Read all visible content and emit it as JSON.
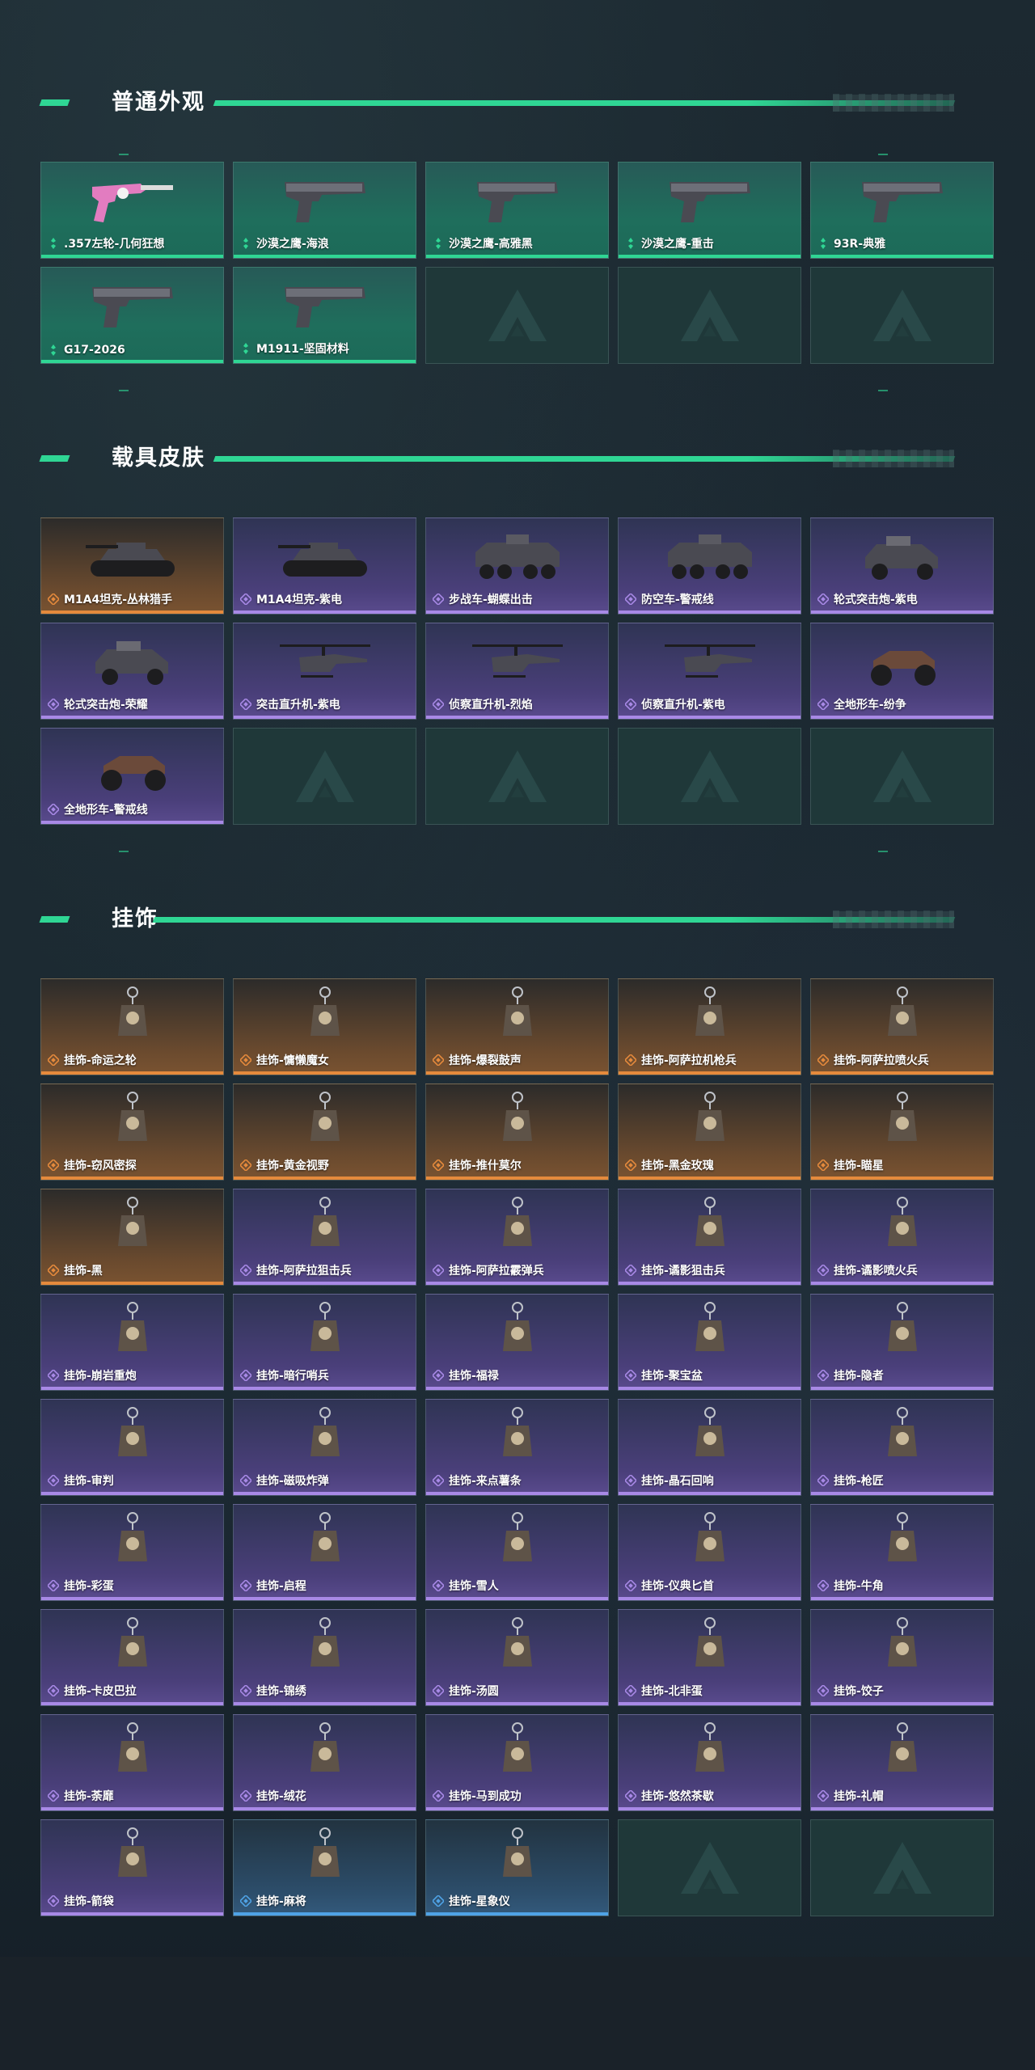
{
  "sections": [
    {
      "title": "普通外观",
      "items": [
        {
          "label": ".357左轮-几何狂想",
          "rarity": "green",
          "icon": "revolver-icon"
        },
        {
          "label": "沙漠之鹰-海浪",
          "rarity": "green",
          "icon": "pistol-icon"
        },
        {
          "label": "沙漠之鹰-高雅黑",
          "rarity": "green",
          "icon": "pistol-icon"
        },
        {
          "label": "沙漠之鹰-重击",
          "rarity": "green",
          "icon": "pistol-icon"
        },
        {
          "label": "93R-典雅",
          "rarity": "green",
          "icon": "pistol-icon"
        },
        {
          "label": "G17-2026",
          "rarity": "green",
          "icon": "pistol-icon"
        },
        {
          "label": "M1911-坚固材料",
          "rarity": "green",
          "icon": "pistol-icon"
        },
        {
          "label": "",
          "rarity": "empty",
          "icon": "logo-icon"
        },
        {
          "label": "",
          "rarity": "empty",
          "icon": "logo-icon"
        },
        {
          "label": "",
          "rarity": "empty",
          "icon": "logo-icon"
        }
      ]
    },
    {
      "title": "载具皮肤",
      "items": [
        {
          "label": "M1A4坦克-丛林猎手",
          "rarity": "orange",
          "icon": "tank-icon"
        },
        {
          "label": "M1A4坦克-紫电",
          "rarity": "purple",
          "icon": "tank-icon"
        },
        {
          "label": "步战车-蝴蝶出击",
          "rarity": "purple",
          "icon": "ifv-icon"
        },
        {
          "label": "防空车-警戒线",
          "rarity": "purple",
          "icon": "ifv-icon"
        },
        {
          "label": "轮式突击炮-紫电",
          "rarity": "purple",
          "icon": "armored-car-icon"
        },
        {
          "label": "轮式突击炮-荣耀",
          "rarity": "purple",
          "icon": "armored-car-icon"
        },
        {
          "label": "突击直升机-紫电",
          "rarity": "purple",
          "icon": "helicopter-icon"
        },
        {
          "label": "侦察直升机-烈焰",
          "rarity": "purple",
          "icon": "helicopter-icon"
        },
        {
          "label": "侦察直升机-紫电",
          "rarity": "purple",
          "icon": "helicopter-icon"
        },
        {
          "label": "全地形车-纷争",
          "rarity": "purple",
          "icon": "atv-icon"
        },
        {
          "label": "全地形车-警戒线",
          "rarity": "purple",
          "icon": "atv-icon"
        },
        {
          "label": "",
          "rarity": "empty",
          "icon": "logo-icon"
        },
        {
          "label": "",
          "rarity": "empty",
          "icon": "logo-icon"
        },
        {
          "label": "",
          "rarity": "empty",
          "icon": "logo-icon"
        },
        {
          "label": "",
          "rarity": "empty",
          "icon": "logo-icon"
        }
      ]
    },
    {
      "title": "挂饰",
      "items": [
        {
          "label": "挂饰-命运之轮",
          "rarity": "orange",
          "icon": "charm-icon"
        },
        {
          "label": "挂饰-慵懒魔女",
          "rarity": "orange",
          "icon": "charm-icon"
        },
        {
          "label": "挂饰-爆裂鼓声",
          "rarity": "orange",
          "icon": "charm-icon"
        },
        {
          "label": "挂饰-阿萨拉机枪兵",
          "rarity": "orange",
          "icon": "charm-icon"
        },
        {
          "label": "挂饰-阿萨拉喷火兵",
          "rarity": "orange",
          "icon": "charm-icon"
        },
        {
          "label": "挂饰-窃风密探",
          "rarity": "orange",
          "icon": "charm-icon"
        },
        {
          "label": "挂饰-黄金视野",
          "rarity": "orange",
          "icon": "charm-icon"
        },
        {
          "label": "挂饰-推什莫尔",
          "rarity": "orange",
          "icon": "charm-icon"
        },
        {
          "label": "挂饰-黑金玫瑰",
          "rarity": "orange",
          "icon": "charm-icon"
        },
        {
          "label": "挂饰-瞄星",
          "rarity": "orange",
          "icon": "charm-icon"
        },
        {
          "label": "挂饰-黑",
          "rarity": "orange",
          "icon": "charm-icon"
        },
        {
          "label": "挂饰-阿萨拉狙击兵",
          "rarity": "purple",
          "icon": "charm-icon"
        },
        {
          "label": "挂饰-阿萨拉霰弹兵",
          "rarity": "purple",
          "icon": "charm-icon"
        },
        {
          "label": "挂饰-谲影狙击兵",
          "rarity": "purple",
          "icon": "charm-icon"
        },
        {
          "label": "挂饰-谲影喷火兵",
          "rarity": "purple",
          "icon": "charm-icon"
        },
        {
          "label": "挂饰-崩岩重炮",
          "rarity": "purple",
          "icon": "charm-icon"
        },
        {
          "label": "挂饰-暗行哨兵",
          "rarity": "purple",
          "icon": "charm-icon"
        },
        {
          "label": "挂饰-福禄",
          "rarity": "purple",
          "icon": "charm-icon"
        },
        {
          "label": "挂饰-聚宝盆",
          "rarity": "purple",
          "icon": "charm-icon"
        },
        {
          "label": "挂饰-隐者",
          "rarity": "purple",
          "icon": "charm-icon"
        },
        {
          "label": "挂饰-审判",
          "rarity": "purple",
          "icon": "charm-icon"
        },
        {
          "label": "挂饰-磁吸炸弹",
          "rarity": "purple",
          "icon": "charm-icon"
        },
        {
          "label": "挂饰-来点薯条",
          "rarity": "purple",
          "icon": "charm-icon"
        },
        {
          "label": "挂饰-晶石回响",
          "rarity": "purple",
          "icon": "charm-icon"
        },
        {
          "label": "挂饰-枪匠",
          "rarity": "purple",
          "icon": "charm-icon"
        },
        {
          "label": "挂饰-彩蛋",
          "rarity": "purple",
          "icon": "charm-icon"
        },
        {
          "label": "挂饰-启程",
          "rarity": "purple",
          "icon": "charm-icon"
        },
        {
          "label": "挂饰-雪人",
          "rarity": "purple",
          "icon": "charm-icon"
        },
        {
          "label": "挂饰-仪典匕首",
          "rarity": "purple",
          "icon": "charm-icon"
        },
        {
          "label": "挂饰-牛角",
          "rarity": "purple",
          "icon": "charm-icon"
        },
        {
          "label": "挂饰-卡皮巴拉",
          "rarity": "purple",
          "icon": "charm-icon"
        },
        {
          "label": "挂饰-锦绣",
          "rarity": "purple",
          "icon": "charm-icon"
        },
        {
          "label": "挂饰-汤圆",
          "rarity": "purple",
          "icon": "charm-icon"
        },
        {
          "label": "挂饰-北非蛋",
          "rarity": "purple",
          "icon": "charm-icon"
        },
        {
          "label": "挂饰-饺子",
          "rarity": "purple",
          "icon": "charm-icon"
        },
        {
          "label": "挂饰-荼靡",
          "rarity": "purple",
          "icon": "charm-icon"
        },
        {
          "label": "挂饰-绒花",
          "rarity": "purple",
          "icon": "charm-icon"
        },
        {
          "label": "挂饰-马到成功",
          "rarity": "purple",
          "icon": "charm-icon"
        },
        {
          "label": "挂饰-悠然茶歇",
          "rarity": "purple",
          "icon": "charm-icon"
        },
        {
          "label": "挂饰-礼帽",
          "rarity": "purple",
          "icon": "charm-icon"
        },
        {
          "label": "挂饰-箭袋",
          "rarity": "purple",
          "icon": "charm-icon"
        },
        {
          "label": "挂饰-麻将",
          "rarity": "blue",
          "icon": "charm-icon"
        },
        {
          "label": "挂饰-星象仪",
          "rarity": "blue",
          "icon": "charm-icon"
        },
        {
          "label": "",
          "rarity": "empty",
          "icon": "logo-icon"
        },
        {
          "label": "",
          "rarity": "empty",
          "icon": "logo-icon"
        }
      ]
    }
  ],
  "colors": {
    "accent_green": "#2fd694",
    "rarity_green": "#2fd694",
    "rarity_purple": "#a889e6",
    "rarity_orange": "#e58a3c",
    "rarity_blue": "#4fa3e6"
  }
}
